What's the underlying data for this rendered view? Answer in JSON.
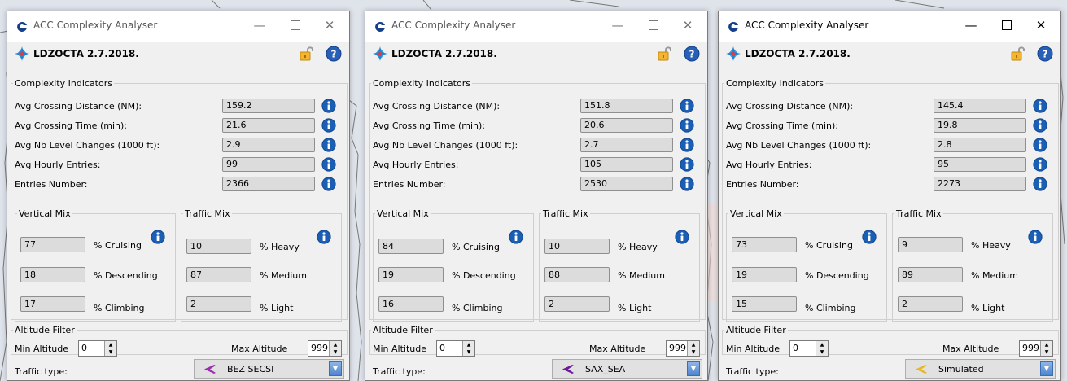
{
  "colors": {
    "info_blue": "#1a5fb4",
    "title_bar": "#ffffff",
    "window_bg": "#f0f0f0",
    "field_bg": "#dcdcdc"
  },
  "windows": [
    {
      "title": "ACC Complexity Analyser",
      "sector": "LDZOCTA 2.7.2018.",
      "ci": {
        "legend": "Complexity Indicators",
        "rows": [
          {
            "label": "Avg Crossing Distance (NM):",
            "value": "159.2"
          },
          {
            "label": "Avg Crossing Time (min):",
            "value": "21.6"
          },
          {
            "label": "Avg Nb Level Changes (1000 ft):",
            "value": "2.9"
          },
          {
            "label": "Avg Hourly Entries:",
            "value": "99"
          },
          {
            "label": "Entries Number:",
            "value": "2366"
          }
        ]
      },
      "vm": {
        "legend": "Vertical Mix",
        "rows": [
          {
            "value": "77",
            "label": "% Cruising"
          },
          {
            "value": "18",
            "label": "% Descending"
          },
          {
            "value": "17",
            "label": "% Climbing"
          }
        ]
      },
      "tm": {
        "legend": "Traffic Mix",
        "rows": [
          {
            "value": "10",
            "label": "% Heavy"
          },
          {
            "value": "87",
            "label": "% Medium"
          },
          {
            "value": "2",
            "label": "% Light"
          }
        ]
      },
      "af": {
        "legend": "Altitude Filter",
        "min_label": "Min Altitude",
        "min_value": "0",
        "max_label": "Max Altitude",
        "max_value": "999"
      },
      "traffic": {
        "label": "Traffic type:",
        "value": "BEZ SECSI",
        "icon_color": "#9b2fae"
      }
    },
    {
      "title": "ACC Complexity Analyser",
      "sector": "LDZOCTA 2.7.2018.",
      "ci": {
        "legend": "Complexity Indicators",
        "rows": [
          {
            "label": "Avg Crossing Distance (NM):",
            "value": "151.8"
          },
          {
            "label": "Avg Crossing Time (min):",
            "value": "20.6"
          },
          {
            "label": "Avg Nb Level Changes (1000 ft):",
            "value": "2.7"
          },
          {
            "label": "Avg Hourly Entries:",
            "value": "105"
          },
          {
            "label": "Entries Number:",
            "value": "2530"
          }
        ]
      },
      "vm": {
        "legend": "Vertical Mix",
        "rows": [
          {
            "value": "84",
            "label": "% Cruising"
          },
          {
            "value": "19",
            "label": "% Descending"
          },
          {
            "value": "16",
            "label": "% Climbing"
          }
        ]
      },
      "tm": {
        "legend": "Traffic Mix",
        "rows": [
          {
            "value": "10",
            "label": "% Heavy"
          },
          {
            "value": "88",
            "label": "% Medium"
          },
          {
            "value": "2",
            "label": "% Light"
          }
        ]
      },
      "af": {
        "legend": "Altitude Filter",
        "min_label": "Min Altitude",
        "min_value": "0",
        "max_label": "Max Altitude",
        "max_value": "999"
      },
      "traffic": {
        "label": "Traffic type:",
        "value": "SAX_SEA",
        "icon_color": "#6a1b9a"
      }
    },
    {
      "title": "ACC Complexity Analyser",
      "sector": "LDZOCTA 2.7.2018.",
      "ci": {
        "legend": "Complexity Indicators",
        "rows": [
          {
            "label": "Avg Crossing Distance (NM):",
            "value": "145.4"
          },
          {
            "label": "Avg Crossing Time (min):",
            "value": "19.8"
          },
          {
            "label": "Avg Nb Level Changes (1000 ft):",
            "value": "2.8"
          },
          {
            "label": "Avg Hourly Entries:",
            "value": "95"
          },
          {
            "label": "Entries Number:",
            "value": "2273"
          }
        ]
      },
      "vm": {
        "legend": "Vertical Mix",
        "rows": [
          {
            "value": "73",
            "label": "% Cruising"
          },
          {
            "value": "19",
            "label": "% Descending"
          },
          {
            "value": "15",
            "label": "% Climbing"
          }
        ]
      },
      "tm": {
        "legend": "Traffic Mix",
        "rows": [
          {
            "value": "9",
            "label": "% Heavy"
          },
          {
            "value": "89",
            "label": "% Medium"
          },
          {
            "value": "2",
            "label": "% Light"
          }
        ]
      },
      "af": {
        "legend": "Altitude Filter",
        "min_label": "Min Altitude",
        "min_value": "0",
        "max_label": "Max Altitude",
        "max_value": "999"
      },
      "traffic": {
        "label": "Traffic type:",
        "value": "Simulated",
        "icon_color": "#e8b62a"
      }
    }
  ]
}
